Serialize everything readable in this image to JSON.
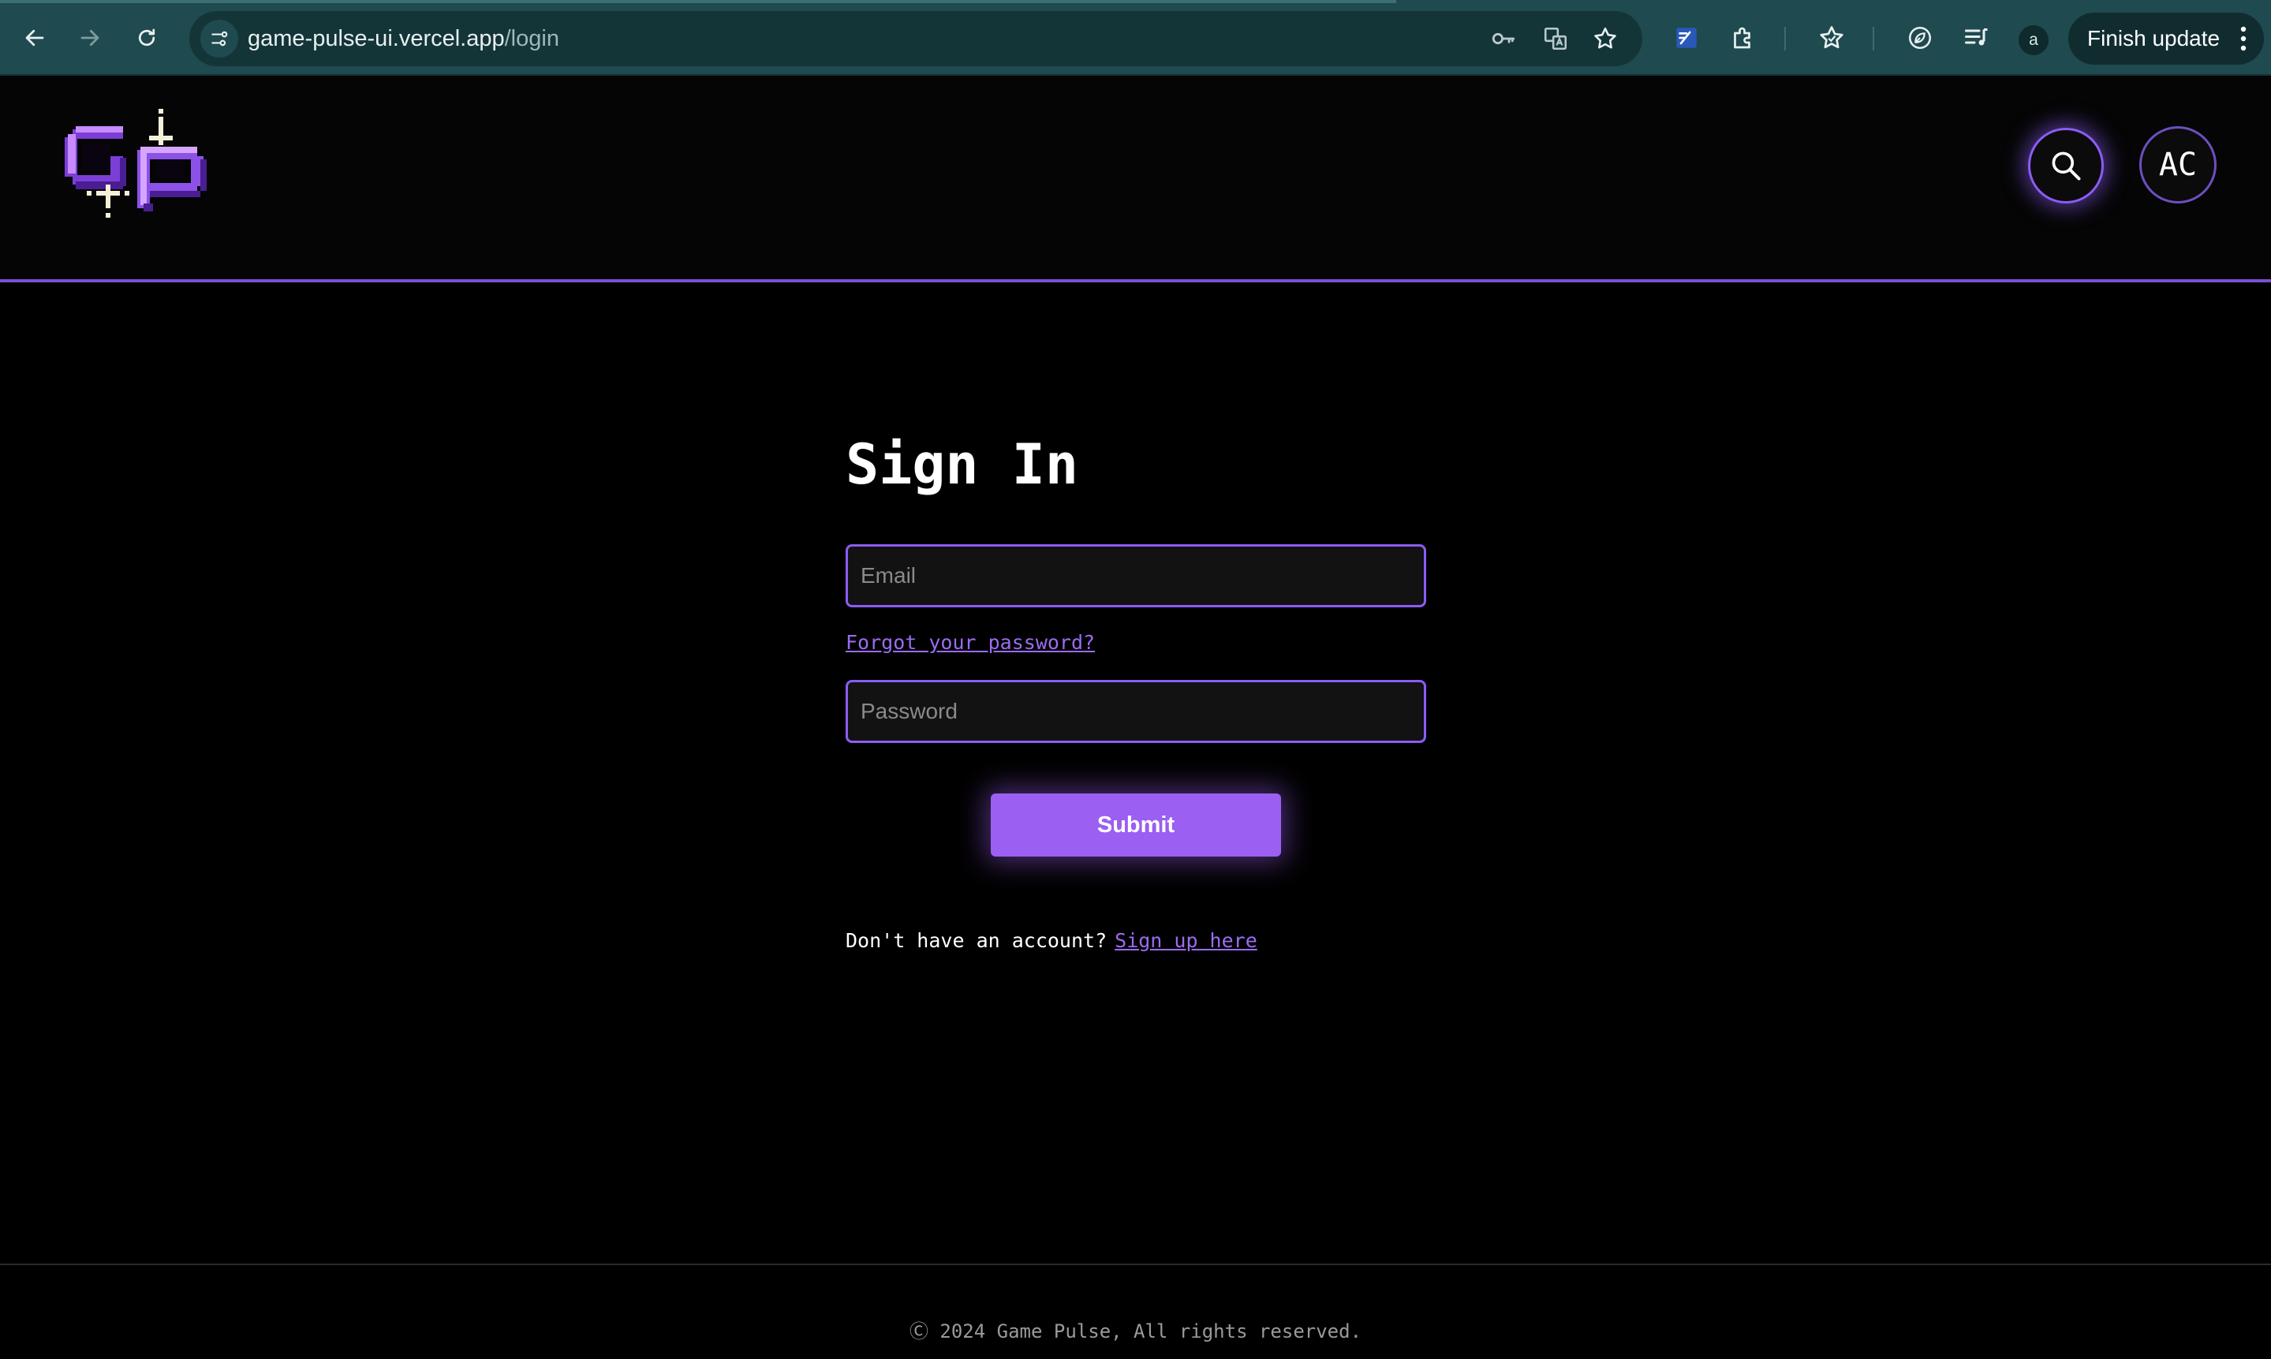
{
  "browser": {
    "url_host": "game-pulse-ui.vercel.app",
    "url_path": "/login",
    "profile_initial": "a",
    "update_label": "Finish update",
    "icons": [
      "back-arrow-icon",
      "forward-arrow-icon",
      "reload-icon",
      "site-info-icon",
      "password-key-icon",
      "translate-icon",
      "bookmark-star-icon",
      "extension-pen-icon",
      "extensions-puzzle-icon",
      "favorites-star-icon",
      "performance-leaf-icon",
      "media-queue-icon",
      "menu-dots-icon"
    ]
  },
  "header": {
    "logo_alt": "GP",
    "avatar_initials": "AC",
    "accent_color": "#8b5cf6"
  },
  "form": {
    "title": "Sign In",
    "email_placeholder": "Email",
    "forgot_label": "Forgot your password?",
    "password_placeholder": "Password",
    "submit_label": "Submit",
    "signup_prompt": "Don't have an account?",
    "signup_link": "Sign up here"
  },
  "footer": {
    "copyright": "Ⓒ 2024 Game Pulse, All rights reserved."
  }
}
